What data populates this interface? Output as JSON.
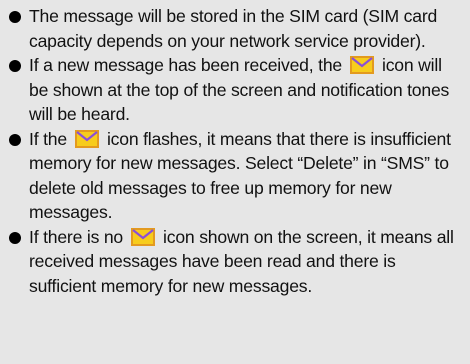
{
  "items": [
    {
      "text": "The message will be stored in the SIM card (SIM card capacity depends on your network service provider)."
    },
    {
      "before": "If a new message has been received, the",
      "icon": "envelope-icon",
      "after": "icon will be shown at the top of the screen and notification tones will be heard."
    },
    {
      "before": "If the",
      "icon": "envelope-icon",
      "after": "icon flashes, it means that there is insufficient memory for new messages. Select “Delete” in “SMS” to delete old messages to free up memory for new messages."
    },
    {
      "before": "If there is no",
      "icon": "envelope-icon",
      "after": "icon shown on the screen, it means all received messages have been read and there is sufficient memory for new messages."
    }
  ],
  "colors": {
    "background": "#e6e6e6",
    "text": "#111111",
    "icon_fill": "#f7cc1c",
    "icon_border": "#e39a1f",
    "icon_flap": "#8a4fd8"
  }
}
